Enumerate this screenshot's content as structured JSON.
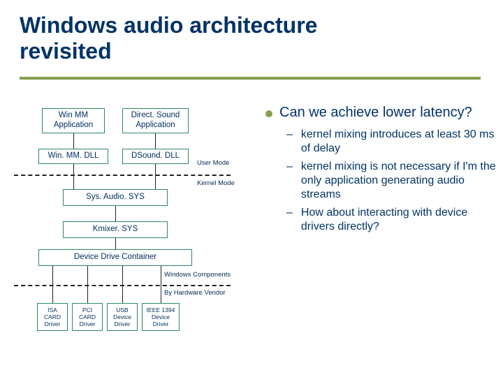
{
  "title_line1": "Windows audio architecture",
  "title_line2": "revisited",
  "diagram": {
    "winmm_app": "Win MM\nApplication",
    "dsound_app": "Direct. Sound\nApplication",
    "winmm_dll": "Win. MM. DLL",
    "dsound_dll": "DSound. DLL",
    "user_mode": "User Mode",
    "kernel_mode": "Kernel Mode",
    "sysaudio": "Sys. Audio. SYS",
    "kmixer": "Kmixer. SYS",
    "ddc": "Device Drive Container",
    "win_components": "Windows Components",
    "by_vendor": "By Hardware Vendor",
    "isa": "ISA\nCARD\nDriver",
    "pci": "PCI\nCARD\nDriver",
    "usb": "USB\nDevice\nDriver",
    "ieee": "IEEE 1394\nDevice\nDriver"
  },
  "bullets": {
    "lead": "Can we achieve lower latency?",
    "sub": [
      "kernel mixing introduces at least 30 ms of delay",
      "kernel mixing is not necessary if I'm the only application generating audio streams",
      "How about interacting with device drivers directly?"
    ]
  }
}
